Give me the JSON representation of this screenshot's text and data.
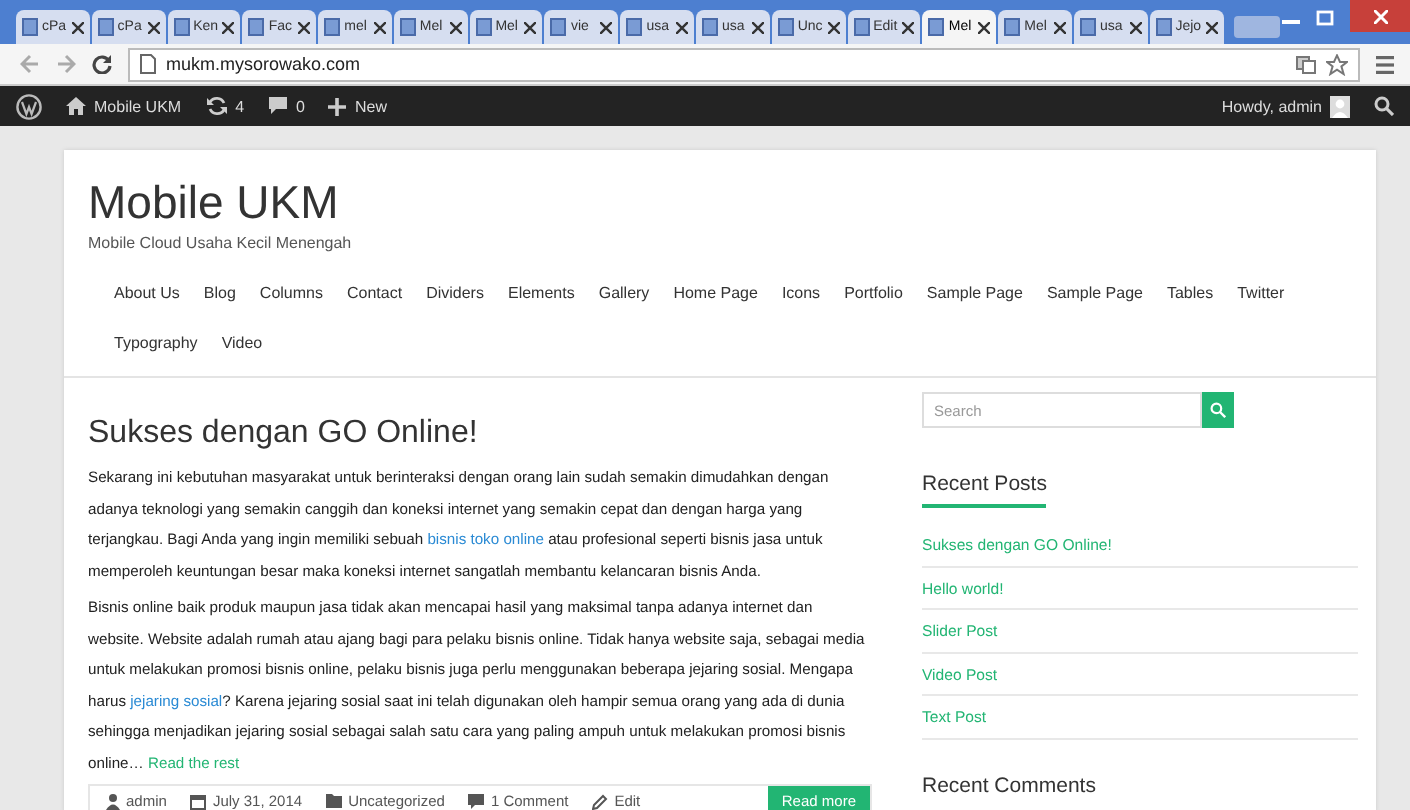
{
  "browser": {
    "tabs": [
      {
        "title": "cPa",
        "selected": false
      },
      {
        "title": "cPa",
        "selected": false
      },
      {
        "title": "Ken",
        "selected": false
      },
      {
        "title": "Fac",
        "selected": false
      },
      {
        "title": "mel",
        "selected": false
      },
      {
        "title": "Mel",
        "selected": false
      },
      {
        "title": "Mel",
        "selected": false
      },
      {
        "title": "vie",
        "selected": false
      },
      {
        "title": "usa",
        "selected": false
      },
      {
        "title": "usa",
        "selected": false
      },
      {
        "title": "Unc",
        "selected": false
      },
      {
        "title": "Edit",
        "selected": false
      },
      {
        "title": "Mel",
        "selected": true
      },
      {
        "title": "Mel",
        "selected": false
      },
      {
        "title": "usa",
        "selected": false
      },
      {
        "title": "Jejo",
        "selected": false
      }
    ],
    "address": "mukm.mysorowako.com"
  },
  "admin_bar": {
    "site": "Mobile UKM",
    "updates": "4",
    "comments": "0",
    "new": "New",
    "greeting": "Howdy, admin"
  },
  "site": {
    "title": "Mobile UKM",
    "tagline": "Mobile Cloud Usaha Kecil Menengah",
    "nav": [
      "About Us",
      "Blog",
      "Columns",
      "Contact",
      "Dividers",
      "Elements",
      "Gallery",
      "Home Page",
      "Icons",
      "Portfolio",
      "Sample Page",
      "Sample Page",
      "Tables",
      "Twitter",
      "Typography",
      "Video"
    ]
  },
  "post": {
    "title": "Sukses dengan GO Online!",
    "paragraphs": [
      {
        "parts": [
          {
            "kind": "text",
            "text": "Sekarang ini kebutuhan masyarakat untuk berinteraksi dengan orang lain sudah semakin dimudahkan dengan adanya teknologi yang semakin canggih dan koneksi internet yang semakin cepat dan dengan harga yang terjangkau. Bagi Anda yang ingin memiliki sebuah "
          },
          {
            "kind": "link",
            "text": "bisnis toko online"
          },
          {
            "kind": "text",
            "text": " atau profesional seperti bisnis jasa untuk memperoleh keuntungan besar maka koneksi internet sangatlah membantu kelancaran bisnis Anda."
          }
        ]
      },
      {
        "parts": [
          {
            "kind": "text",
            "text": "Bisnis online baik produk maupun jasa tidak akan mencapai hasil yang maksimal tanpa adanya internet dan website. Website adalah rumah atau ajang bagi para pelaku bisnis online. Tidak hanya website saja, sebagai media untuk melakukan promosi bisnis online, pelaku bisnis juga perlu menggunakan beberapa jejaring sosial. Mengapa harus "
          },
          {
            "kind": "link",
            "text": "jejaring sosial"
          },
          {
            "kind": "text",
            "text": "? Karena jejaring sosial saat ini telah digunakan oleh hampir semua orang yang ada di dunia sehingga menjadikan jejaring sosial sebagai salah satu cara yang paling ampuh untuk melakukan promosi bisnis online… "
          },
          {
            "kind": "more",
            "text": "Read the rest"
          }
        ]
      }
    ],
    "meta": {
      "author": "admin",
      "date": "July 31, 2014",
      "category": "Uncategorized",
      "comments": "1 Comment",
      "edit": "Edit"
    },
    "read_more": "Read more"
  },
  "sidebar": {
    "search_placeholder": "Search",
    "recent_posts_title": "Recent Posts",
    "recent_posts": [
      "Sukses dengan GO Online!",
      "Hello world!",
      "Slider Post",
      "Video Post",
      "Text Post"
    ],
    "recent_comments_title": "Recent Comments"
  }
}
